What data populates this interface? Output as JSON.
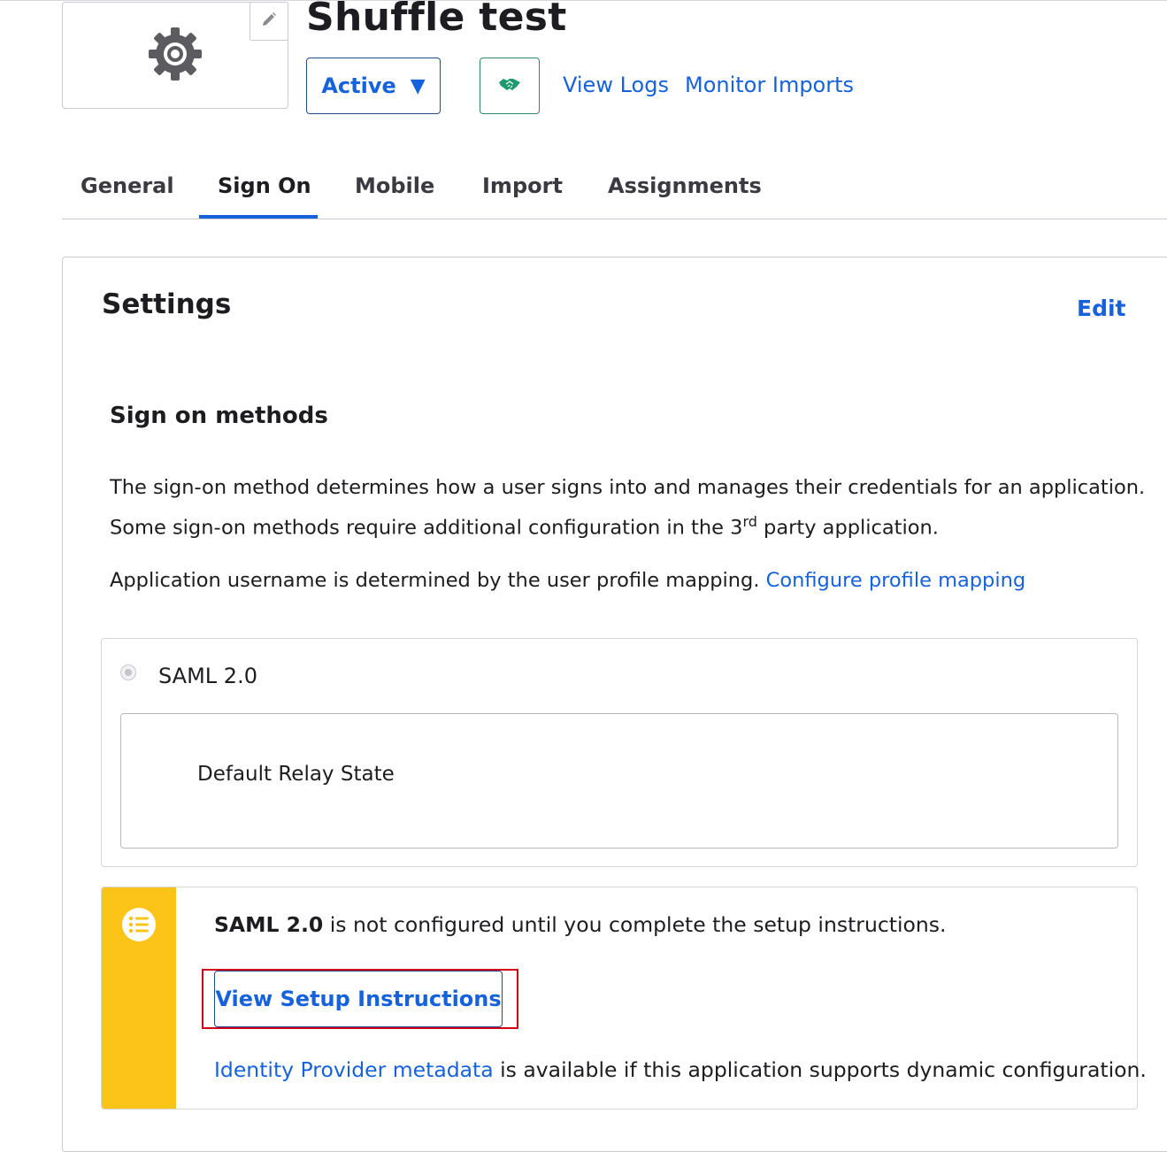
{
  "app": {
    "title": "Shuffle test",
    "logo_icon": "gear-icon",
    "edit_logo_icon": "pencil-icon"
  },
  "header": {
    "status_label": "Active",
    "status_caret": "▼",
    "push_icon": "handshake-icon",
    "view_logs": "View Logs",
    "monitor_imports": "Monitor Imports"
  },
  "tabs": [
    {
      "label": "General"
    },
    {
      "label": "Sign On",
      "active": true
    },
    {
      "label": "Mobile"
    },
    {
      "label": "Import"
    },
    {
      "label": "Assignments"
    }
  ],
  "settings": {
    "title": "Settings",
    "edit": "Edit",
    "methods_title": "Sign on methods",
    "description_line1": "The sign-on method determines how a user signs into and manages their credentials for an application.",
    "description_line2_pre": "Some sign-on methods require additional configuration in the 3",
    "description_line2_sup": "rd",
    "description_line2_post": " party application.",
    "username_text": "Application username is determined by the user profile mapping. ",
    "username_link": "Configure profile mapping"
  },
  "saml": {
    "label": "SAML 2.0",
    "relay_state_label": "Default Relay State"
  },
  "callout": {
    "icon": "list-icon",
    "strong": "SAML 2.0",
    "text": " is not configured until you complete the setup instructions.",
    "button": "View Setup Instructions",
    "metadata_link": "Identity Provider metadata",
    "metadata_text": " is available if this application supports dynamic configuration."
  },
  "colors": {
    "link": "#1662dd",
    "callout_bar": "#fcc419",
    "highlight": "#d0021b",
    "push_green": "#1f9a6e"
  }
}
